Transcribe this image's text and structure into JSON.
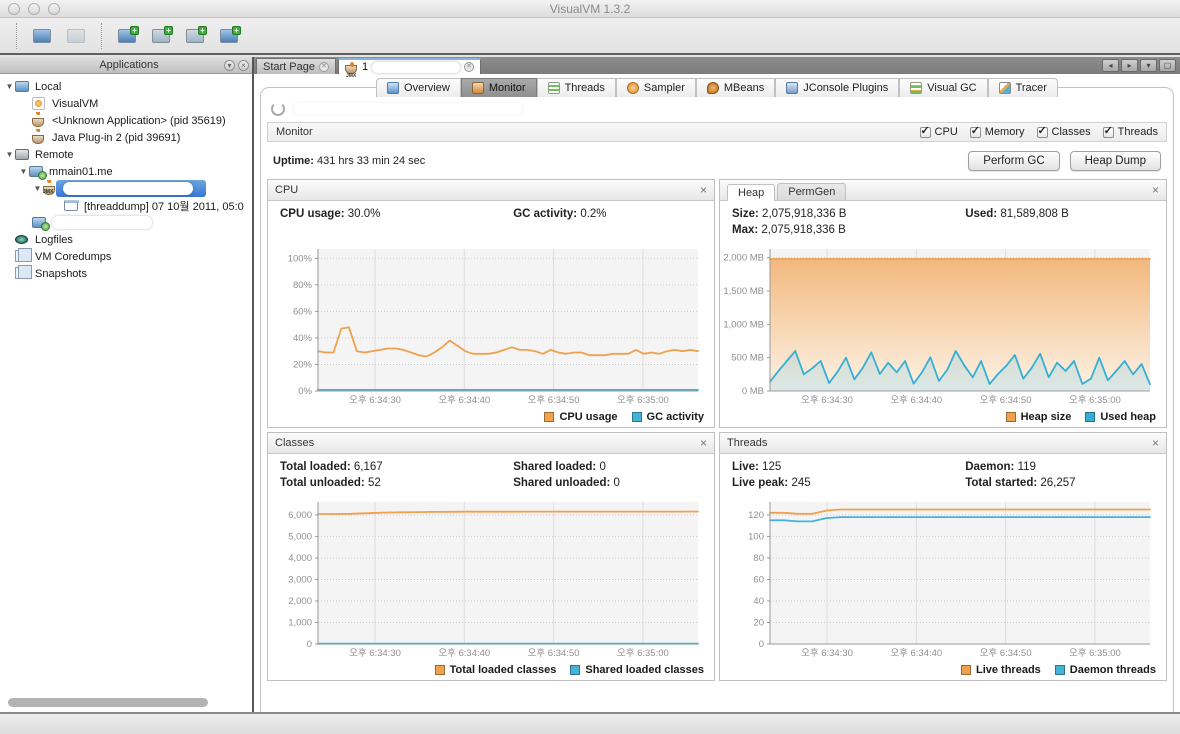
{
  "window": {
    "title": "VisualVM 1.3.2"
  },
  "toolbar": {
    "icons": [
      {
        "name": "load-snapshot"
      },
      {
        "name": "save-snapshot"
      },
      {
        "name": "add-jmx-connection"
      },
      {
        "name": "add-vm-coredump"
      },
      {
        "name": "add-application-snapshot"
      },
      {
        "name": "add-remote-host"
      }
    ]
  },
  "sidebar": {
    "header": {
      "title": "Applications"
    },
    "tree": [
      {
        "label": "Local"
      },
      {
        "label": "VisualVM"
      },
      {
        "label": "<Unknown Application> (pid 35619)"
      },
      {
        "label": "Java Plug-in 2 (pid 39691)"
      },
      {
        "label": "Remote"
      },
      {
        "label": "mmain01.me"
      },
      {
        "label": ""
      },
      {
        "label": "[threaddump] 07 10월 2011, 05:0"
      },
      {
        "label": ""
      },
      {
        "label": "Logfiles"
      },
      {
        "label": "VM Coredumps"
      },
      {
        "label": "Snapshots"
      }
    ]
  },
  "tabs": [
    {
      "label": "Start Page",
      "selected": false
    },
    {
      "label": "1",
      "selected": true,
      "censored": true
    }
  ],
  "inner_tabs": [
    {
      "label": "Overview"
    },
    {
      "label": "Monitor",
      "selected": true
    },
    {
      "label": "Threads"
    },
    {
      "label": "Sampler"
    },
    {
      "label": "MBeans"
    },
    {
      "label": "JConsole Plugins"
    },
    {
      "label": "Visual GC"
    },
    {
      "label": "Tracer"
    }
  ],
  "monitor": {
    "section_title": "Monitor",
    "checkboxes": [
      {
        "label": "CPU",
        "checked": true
      },
      {
        "label": "Memory",
        "checked": true
      },
      {
        "label": "Classes",
        "checked": true
      },
      {
        "label": "Threads",
        "checked": true
      }
    ],
    "uptime_label": "Uptime:",
    "uptime_value": "431 hrs 33 min 24 sec",
    "perform_gc_label": "Perform GC",
    "heap_dump_label": "Heap Dump"
  },
  "panels": {
    "cpu": {
      "title": "CPU",
      "stats": {
        "left": [
          {
            "label": "CPU usage:",
            "value": "30.0%"
          }
        ],
        "right": [
          {
            "label": "GC activity:",
            "value": "0.2%"
          }
        ]
      }
    },
    "heap": {
      "tabs": [
        {
          "label": "Heap",
          "selected": true
        },
        {
          "label": "PermGen",
          "selected": false
        }
      ],
      "stats": {
        "left": [
          {
            "label": "Size:",
            "value": "2,075,918,336 B"
          },
          {
            "label": "Max:",
            "value": "2,075,918,336 B"
          }
        ],
        "right": [
          {
            "label": "Used:",
            "value": "81,589,808 B"
          }
        ]
      }
    },
    "classes": {
      "title": "Classes",
      "stats": {
        "left": [
          {
            "label": "Total loaded:",
            "value": "6,167"
          },
          {
            "label": "Total unloaded:",
            "value": "52"
          }
        ],
        "right": [
          {
            "label": "Shared loaded:",
            "value": "0"
          },
          {
            "label": "Shared unloaded:",
            "value": "0"
          }
        ]
      }
    },
    "threads": {
      "title": "Threads",
      "stats": {
        "left": [
          {
            "label": "Live:",
            "value": "125"
          },
          {
            "label": "Live peak:",
            "value": "245"
          }
        ],
        "right": [
          {
            "label": "Daemon:",
            "value": "119"
          },
          {
            "label": "Total started:",
            "value": "26,257"
          }
        ]
      }
    }
  },
  "colors": {
    "orange": "#EFA14E",
    "blue": "#45B2D8",
    "selection_blue": "#3875d7"
  },
  "chart_data": [
    {
      "id": "cpu",
      "type": "line",
      "title": "CPU",
      "ylim": [
        0,
        107
      ],
      "yticks": [
        {
          "v": 0,
          "label": "0%"
        },
        {
          "v": 20,
          "label": "20%"
        },
        {
          "v": 40,
          "label": "40%"
        },
        {
          "v": 60,
          "label": "60%"
        },
        {
          "v": 80,
          "label": "80%"
        },
        {
          "v": 100,
          "label": "100%"
        }
      ],
      "xticks": [
        {
          "f": 0.15,
          "label": "오후 6:34:30"
        },
        {
          "f": 0.385,
          "label": "오후 6:34:40"
        },
        {
          "f": 0.62,
          "label": "오후 6:34:50"
        },
        {
          "f": 0.855,
          "label": "오후 6:35:00"
        }
      ],
      "series": [
        {
          "name": "CPU usage",
          "color": "#EFA14E",
          "values": [
            30,
            29,
            29,
            47,
            48,
            30,
            29,
            30,
            31,
            32,
            32,
            31,
            29,
            27,
            26,
            29,
            33,
            38,
            34,
            30,
            28,
            28,
            28,
            29,
            31,
            33,
            31,
            31,
            30,
            28,
            31,
            29,
            28,
            29,
            29,
            27,
            27,
            27,
            28,
            28,
            28,
            31,
            28,
            29,
            28,
            30,
            31,
            30,
            31,
            30
          ]
        },
        {
          "name": "GC activity",
          "color": "#45B2D8",
          "values": [
            0.8,
            0.8
          ]
        }
      ]
    },
    {
      "id": "heap",
      "type": "area",
      "title": "Heap",
      "ylim": [
        0,
        2130
      ],
      "yticks": [
        {
          "v": 0,
          "label": "0 MB"
        },
        {
          "v": 500,
          "label": "500 MB"
        },
        {
          "v": 1000,
          "label": "1,000 MB"
        },
        {
          "v": 1500,
          "label": "1,500 MB"
        },
        {
          "v": 2000,
          "label": "2,000 MB"
        }
      ],
      "xticks": [
        {
          "f": 0.15,
          "label": "오후 6:34:30"
        },
        {
          "f": 0.385,
          "label": "오후 6:34:40"
        },
        {
          "f": 0.62,
          "label": "오후 6:34:50"
        },
        {
          "f": 0.855,
          "label": "오후 6:35:00"
        }
      ],
      "series": [
        {
          "name": "Heap size",
          "color": "#EFA14E",
          "fill": "orange-gradient",
          "values": [
            1980,
            1980
          ]
        },
        {
          "name": "Used heap",
          "color": "#35AFD6",
          "fill": "rgba(130,205,232,0.28)",
          "values": [
            140,
            300,
            450,
            600,
            250,
            340,
            450,
            120,
            290,
            500,
            175,
            350,
            580,
            255,
            425,
            280,
            450,
            110,
            280,
            505,
            150,
            320,
            600,
            385,
            205,
            450,
            105,
            255,
            380,
            540,
            185,
            350,
            560,
            205,
            425,
            300,
            450,
            105,
            185,
            500,
            160,
            300,
            450,
            250,
            405,
            100
          ]
        }
      ]
    },
    {
      "id": "classes",
      "type": "line",
      "title": "Classes",
      "ylim": [
        0,
        6600
      ],
      "yticks": [
        {
          "v": 0,
          "label": "0"
        },
        {
          "v": 1000,
          "label": "1,000"
        },
        {
          "v": 2000,
          "label": "2,000"
        },
        {
          "v": 3000,
          "label": "3,000"
        },
        {
          "v": 4000,
          "label": "4,000"
        },
        {
          "v": 5000,
          "label": "5,000"
        },
        {
          "v": 6000,
          "label": "6,000"
        }
      ],
      "xticks": [
        {
          "f": 0.15,
          "label": "오후 6:34:30"
        },
        {
          "f": 0.385,
          "label": "오후 6:34:40"
        },
        {
          "f": 0.62,
          "label": "오후 6:34:50"
        },
        {
          "f": 0.855,
          "label": "오후 6:35:00"
        }
      ],
      "series": [
        {
          "name": "Total loaded classes",
          "color": "#EFA14E",
          "values": [
            6040,
            6042,
            6050,
            6080,
            6105,
            6122,
            6132,
            6140,
            6145,
            6148,
            6150,
            6150,
            6151,
            6152,
            6152,
            6153,
            6153,
            6154,
            6154,
            6155,
            6155,
            6156,
            6156,
            6157
          ]
        },
        {
          "name": "Shared loaded classes",
          "color": "#45B2D8",
          "values": [
            15,
            15
          ]
        }
      ]
    },
    {
      "id": "threads",
      "type": "line",
      "title": "Threads",
      "ylim": [
        0,
        132
      ],
      "yticks": [
        {
          "v": 0,
          "label": "0"
        },
        {
          "v": 20,
          "label": "20"
        },
        {
          "v": 40,
          "label": "40"
        },
        {
          "v": 60,
          "label": "60"
        },
        {
          "v": 80,
          "label": "80"
        },
        {
          "v": 100,
          "label": "100"
        },
        {
          "v": 120,
          "label": "120"
        }
      ],
      "xticks": [
        {
          "f": 0.15,
          "label": "오후 6:34:30"
        },
        {
          "f": 0.385,
          "label": "오후 6:34:40"
        },
        {
          "f": 0.62,
          "label": "오후 6:34:50"
        },
        {
          "f": 0.855,
          "label": "오후 6:35:00"
        }
      ],
      "series": [
        {
          "name": "Live threads",
          "color": "#EFA14E",
          "values": [
            122,
            122,
            121,
            121,
            124,
            125,
            125,
            125,
            125,
            125,
            125,
            125,
            125,
            125,
            125,
            125,
            125,
            125,
            125,
            125,
            125,
            125,
            125,
            125,
            125,
            125,
            125,
            125
          ]
        },
        {
          "name": "Daemon threads",
          "color": "#45B2D8",
          "values": [
            115,
            115,
            114,
            114,
            117,
            118,
            118,
            118,
            118,
            118,
            118,
            118,
            118,
            118,
            118,
            118,
            118,
            118,
            118,
            118,
            118,
            118,
            118,
            118,
            118,
            118,
            118,
            118
          ]
        }
      ]
    }
  ]
}
